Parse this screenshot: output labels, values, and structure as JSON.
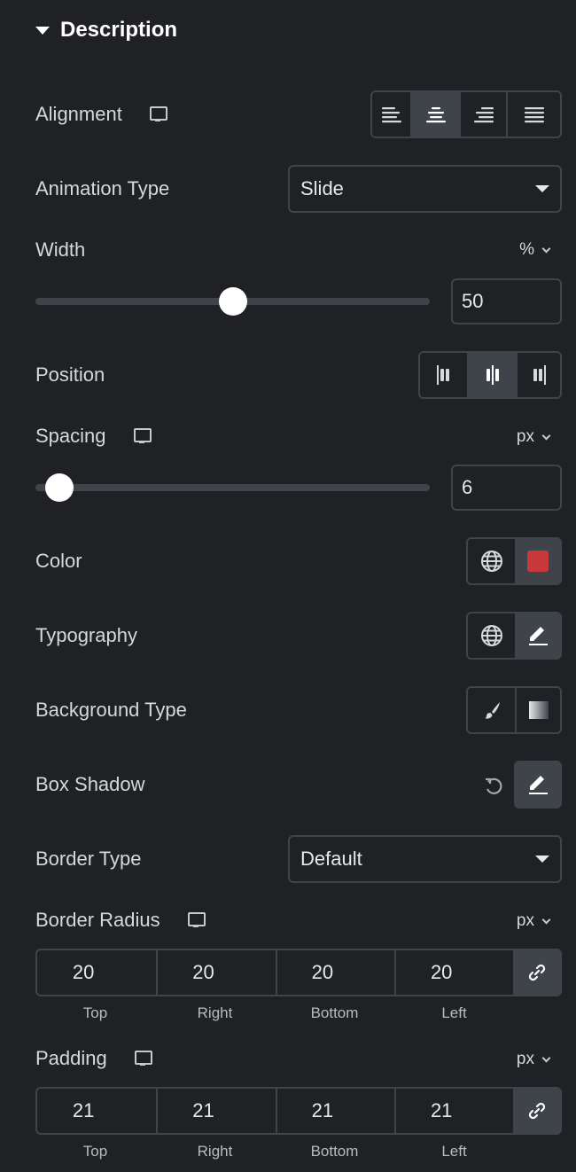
{
  "section": {
    "title": "Description",
    "expanded": true
  },
  "alignment": {
    "label": "Alignment",
    "responsive_icon": "monitor-icon",
    "options": [
      {
        "name": "align-left",
        "icon": "align-left-icon",
        "active": false
      },
      {
        "name": "align-center",
        "icon": "align-center-icon",
        "active": true
      },
      {
        "name": "align-right",
        "icon": "align-right-icon",
        "active": false
      },
      {
        "name": "align-justify",
        "icon": "align-justify-icon",
        "active": false
      }
    ]
  },
  "animation_type": {
    "label": "Animation Type",
    "value": "Slide"
  },
  "width": {
    "label": "Width",
    "unit": "%",
    "value": "50",
    "slider_fraction": 0.5
  },
  "position": {
    "label": "Position",
    "options": [
      {
        "name": "position-left",
        "active": false
      },
      {
        "name": "position-center",
        "active": true
      },
      {
        "name": "position-right",
        "active": false
      }
    ]
  },
  "spacing": {
    "label": "Spacing",
    "responsive_icon": "monitor-icon",
    "unit": "px",
    "value": "6",
    "slider_fraction": 0.06
  },
  "color": {
    "label": "Color",
    "swatch": "#c8383b",
    "global_icon": "globe-icon"
  },
  "typography": {
    "label": "Typography",
    "global_icon": "globe-icon",
    "edit_icon": "pencil-icon"
  },
  "background_type": {
    "label": "Background Type",
    "options": [
      "classic-brush-icon",
      "gradient-icon"
    ]
  },
  "box_shadow": {
    "label": "Box Shadow",
    "reset_icon": "reset-icon",
    "edit_icon": "pencil-icon"
  },
  "border_type": {
    "label": "Border Type",
    "value": "Default"
  },
  "border_radius": {
    "label": "Border Radius",
    "responsive_icon": "monitor-icon",
    "unit": "px",
    "values": [
      "20",
      "20",
      "20",
      "20"
    ],
    "sides": [
      "Top",
      "Right",
      "Bottom",
      "Left"
    ],
    "linked": true
  },
  "padding": {
    "label": "Padding",
    "responsive_icon": "monitor-icon",
    "unit": "px",
    "values": [
      "21",
      "21",
      "21",
      "21"
    ],
    "sides": [
      "Top",
      "Right",
      "Bottom",
      "Left"
    ],
    "linked": true
  }
}
